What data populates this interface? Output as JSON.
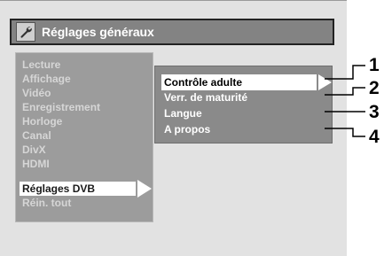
{
  "header": {
    "title": "Réglages généraux",
    "icon": "wrench-icon"
  },
  "main_menu": {
    "items": [
      {
        "label": "Lecture",
        "selected": false
      },
      {
        "label": "Affichage",
        "selected": false
      },
      {
        "label": "Vidéo",
        "selected": false
      },
      {
        "label": "Enregistrement",
        "selected": false
      },
      {
        "label": "Horloge",
        "selected": false
      },
      {
        "label": "Canal",
        "selected": false
      },
      {
        "label": "DivX",
        "selected": false
      },
      {
        "label": "HDMI",
        "selected": false
      },
      {
        "label": "Réglages DVB",
        "selected": true
      },
      {
        "label": "Réin. tout",
        "selected": false
      }
    ]
  },
  "submenu": {
    "items": [
      {
        "label": "Contrôle adulte",
        "selected": true
      },
      {
        "label": "Verr. de maturité",
        "selected": false
      },
      {
        "label": "Langue",
        "selected": false
      },
      {
        "label": "A propos",
        "selected": false
      }
    ]
  },
  "callouts": [
    "1",
    "2",
    "3",
    "4"
  ],
  "colors": {
    "screen_bg": "#e2e2e2",
    "title_bar": "#838383",
    "menu_panel": "#9c9c9c",
    "submenu_panel": "#8a8a8a",
    "highlight": "#ffffff"
  }
}
